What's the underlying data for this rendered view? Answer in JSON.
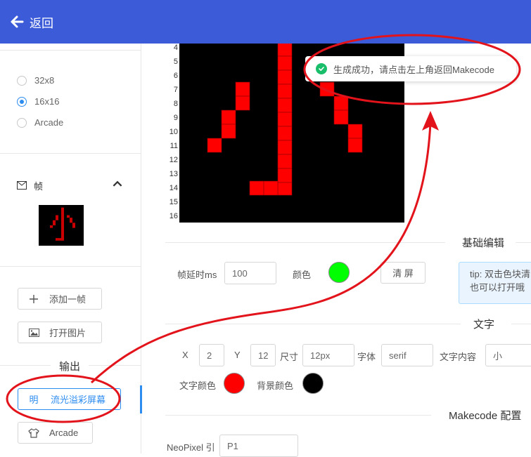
{
  "header": {
    "back_label": "返回"
  },
  "sidebar": {
    "size_options": [
      {
        "label": "32x8",
        "checked": false
      },
      {
        "label": "16x16",
        "checked": true
      },
      {
        "label": "Arcade",
        "checked": false
      }
    ],
    "frames_label": "帧",
    "add_frame_label": "添加一帧",
    "open_image_label": "打开图片",
    "output_label": "输出",
    "output_buttons": [
      {
        "icon_text": "明",
        "label": "流光溢彩屏幕"
      },
      {
        "label": "Arcade"
      }
    ]
  },
  "canvas": {
    "row_numbers": [
      "4",
      "5",
      "6",
      "7",
      "8",
      "9",
      "10",
      "11",
      "12",
      "13",
      "14",
      "15",
      "16"
    ],
    "pixel_color": "#ff0000",
    "background_color": "#000000"
  },
  "basic_edit": {
    "title": "基础编辑",
    "delay_label": "帧延时ms",
    "delay_value": "100",
    "color_label": "颜色",
    "color_value": "#00ff00",
    "clear_label": "清 屏",
    "tip_line1": "tip: 双击色块清",
    "tip_line2": "也可以打开哦"
  },
  "text": {
    "title": "文字",
    "x_label": "X",
    "x_value": "2",
    "y_label": "Y",
    "y_value": "12",
    "size_label": "尺寸",
    "size_value": "12px",
    "font_label": "字体",
    "font_value": "serif",
    "content_label": "文字内容",
    "content_value": "小",
    "text_color_label": "文字颜色",
    "text_color": "#ff0000",
    "bg_color_label": "背景颜色",
    "bg_color": "#000000"
  },
  "makecode": {
    "title": "Makecode 配置",
    "pin_label": "NeoPixel 引",
    "pin_value": "P1"
  },
  "toast": {
    "message": "生成成功，请点击左上角返回Makecode"
  }
}
